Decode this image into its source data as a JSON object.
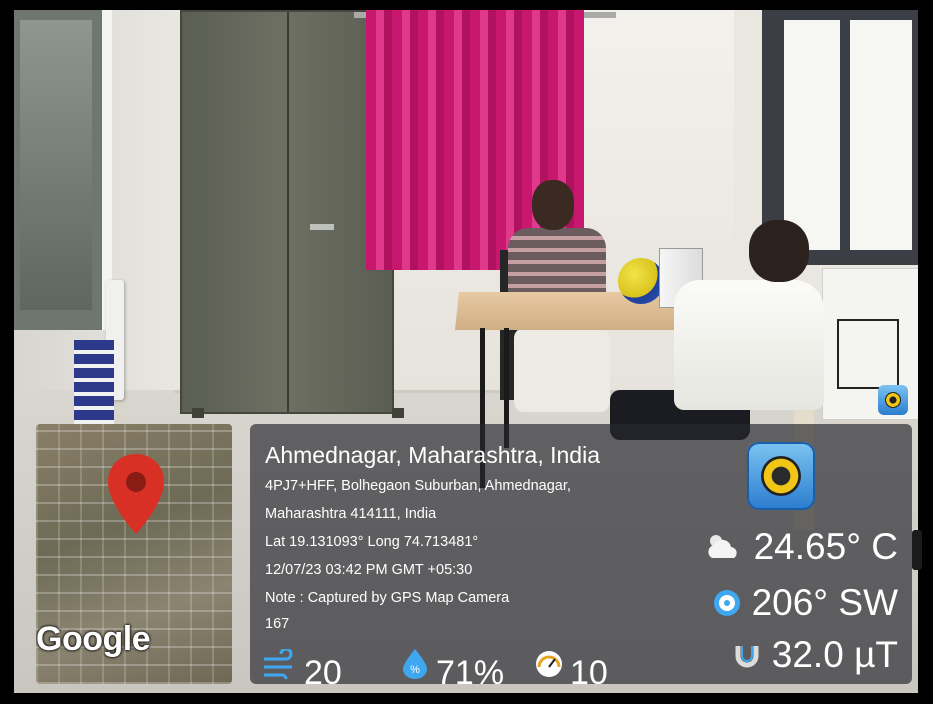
{
  "location": {
    "title": "Ahmednagar, Maharashtra, India",
    "address_line1": "4PJ7+HFF, Bolhegaon Suburban, Ahmednagar,",
    "address_line2": "Maharashtra 414111, India",
    "coords": "Lat 19.131093° Long 74.713481°",
    "datetime": "12/07/23 03:42 PM GMT +05:30",
    "note": "Note : Captured by GPS Map Camera",
    "altitude": "167"
  },
  "map": {
    "provider_logo": "Google",
    "pin_icon": "map-pin-icon",
    "pin_color": "#d93025"
  },
  "metrics": {
    "temperature": "24.65° C",
    "wind_direction": "206° SW",
    "magnetic_field": "32.0 µT",
    "wind_speed": "20",
    "humidity": "71%",
    "pressure": "10"
  },
  "icons": {
    "weather": "cloud-sun-icon",
    "compass": "compass-icon",
    "magnet": "magnet-icon",
    "wind": "wind-icon",
    "humidity": "humidity-drop-icon",
    "pressure": "gauge-icon",
    "app": "gps-map-camera-app-icon"
  },
  "colors": {
    "overlay_bg": "#2c2c31",
    "accent_blue": "#2b7ccf",
    "icon_blue": "#3fa7f0"
  }
}
